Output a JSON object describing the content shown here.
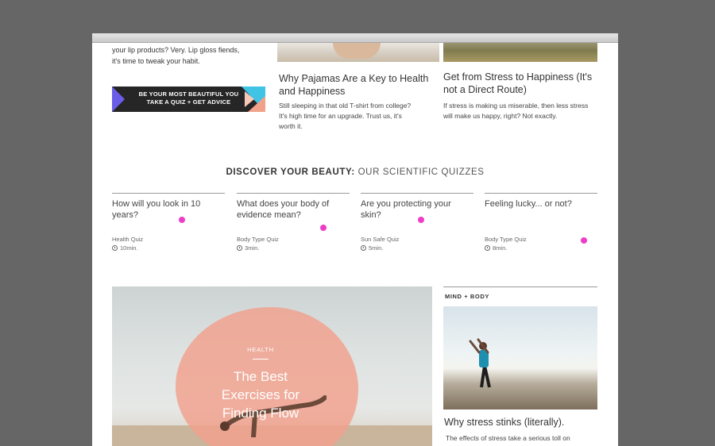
{
  "top_left": {
    "lines": [
      "your lip products? Very. Lip gloss fiends,",
      "it's time to tweak your habit."
    ],
    "banner_line1": "BE YOUR MOST BEAUTIFUL YOU",
    "banner_line2": "TAKE A QUIZ + GET ADVICE"
  },
  "article_pajamas": {
    "title": "Why Pajamas Are a Key to Health and Happiness",
    "description": "Still sleeping in that old T-shirt from college? It's high time for an upgrade. Trust us, it's worth it."
  },
  "article_stress": {
    "title": "Get from Stress to Happiness (It's not a Direct Route)",
    "description": "If stress is making us miserable, then less stress will make us happy, right? Not exactly."
  },
  "quizzes_section": {
    "heading_bold": "DISCOVER YOUR BEAUTY:",
    "heading_light": "OUR SCIENTIFIC QUIZZES",
    "items": [
      {
        "question": "How will you look in 10 years?",
        "category": "Health Quiz",
        "duration": "10min."
      },
      {
        "question": "What does your body of evidence mean?",
        "category": "Body Type Quiz",
        "duration": "3min."
      },
      {
        "question": "Are you protecting your skin?",
        "category": "Sun Safe Quiz",
        "duration": "5min."
      },
      {
        "question": "Feeling lucky... or not?",
        "category": "Body Type Quiz",
        "duration": "8min."
      }
    ]
  },
  "hero": {
    "category": "HEALTH",
    "title_lines": [
      "The Best",
      "Exercises for",
      "Finding Flow"
    ]
  },
  "side_article": {
    "category": "MIND + BODY",
    "title": "Why stress stinks (literally).",
    "description": "The effects of stress take a serious toll on"
  },
  "colors": {
    "accent_dot": "#ee3ec7",
    "hero_blob": "#f2a08c",
    "banner_bg": "#262626"
  }
}
